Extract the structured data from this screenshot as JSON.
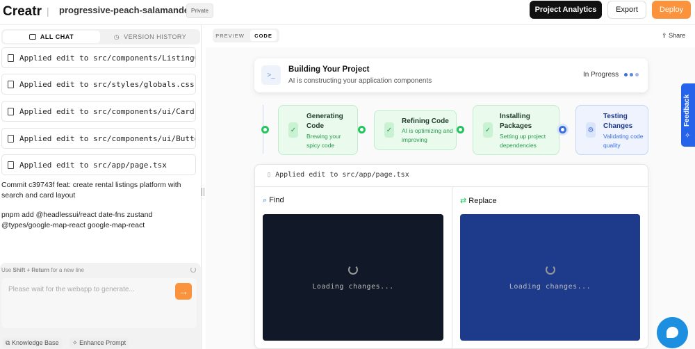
{
  "header": {
    "logo": "Creatr",
    "separator": "|",
    "project": "progressive-peach-salamander",
    "visibility": "Private",
    "analytics": "Project Analytics",
    "export": "Export",
    "deploy": "Deploy"
  },
  "left": {
    "tabs": [
      {
        "label": "ALL CHAT"
      },
      {
        "label": "VERSION HISTORY"
      }
    ],
    "items": [
      "Applied edit to src/components/ListingC...",
      "Applied edit to src/styles/globals.css",
      "Applied edit to src/components/ui/Card....",
      "Applied edit to src/components/ui/Butto...",
      "Applied edit to src/app/page.tsx"
    ],
    "commit": "Commit c39743f feat: create rental listings platform with search and card layout",
    "pnpm": "pnpm add @headlessui/react date-fns zustand @types/google-map-react google-map-react",
    "hint_pre": "Use ",
    "hint_key": "Shift + Return",
    "hint_post": " for a new line",
    "placeholder": "Please wait for the webapp to generate...",
    "knowledge": "Knowledge Base",
    "enhance": "Enhance Prompt"
  },
  "right": {
    "tabs": [
      {
        "label": "PREVIEW"
      },
      {
        "label": "CODE"
      }
    ],
    "share": "Share",
    "build": {
      "title": "Building Your Project",
      "subtitle": "AI is constructing your application components",
      "status": "In Progress"
    },
    "steps": [
      {
        "title": "Generating Code",
        "desc": "Brewing your spicy code",
        "state": "done"
      },
      {
        "title": "Refining Code",
        "desc": "AI is optimizing and improving",
        "state": "done"
      },
      {
        "title": "Installing Packages",
        "desc": "Setting up project dependencies",
        "state": "done"
      },
      {
        "title": "Testing Changes",
        "desc": "Validating code quality",
        "state": "active"
      }
    ],
    "edit": {
      "file": "Applied edit to src/app/page.tsx",
      "find": "Find",
      "replace": "Replace",
      "loading": "Loading changes..."
    }
  },
  "feedback": "Feedback",
  "colors": {
    "accent": "#fb923c",
    "green": "#22c55e",
    "blue": "#2563eb",
    "navy": "#1e3a8a",
    "dark": "#111827"
  }
}
